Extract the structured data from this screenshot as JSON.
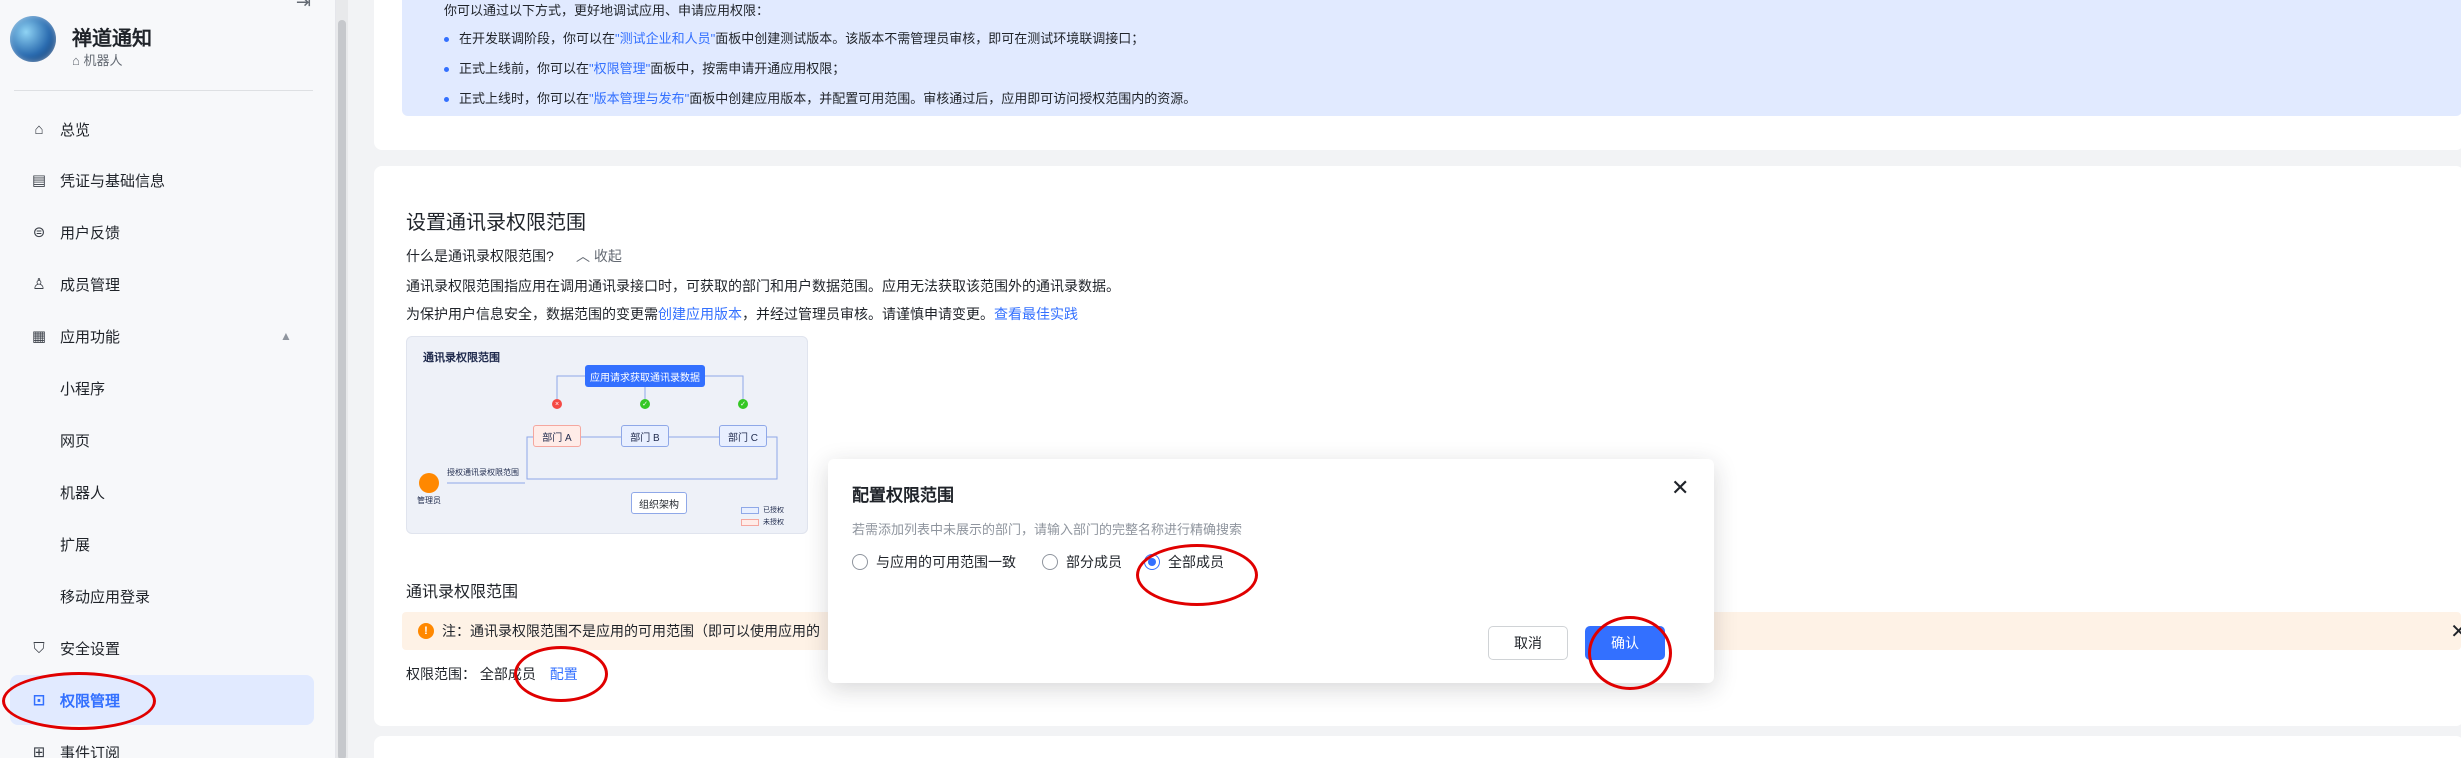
{
  "sidebar": {
    "app_name": "禅道通知",
    "app_type": "机器人",
    "items": [
      {
        "label": "总览",
        "icon": "home-icon"
      },
      {
        "label": "凭证与基础信息",
        "icon": "document-icon"
      },
      {
        "label": "用户反馈",
        "icon": "feedback-icon"
      },
      {
        "label": "成员管理",
        "icon": "user-icon"
      },
      {
        "label": "应用功能",
        "icon": "grid-icon"
      },
      {
        "label": "小程序"
      },
      {
        "label": "网页"
      },
      {
        "label": "机器人"
      },
      {
        "label": "扩展"
      },
      {
        "label": "移动应用登录"
      },
      {
        "label": "安全设置",
        "icon": "shield-icon"
      },
      {
        "label": "权限管理",
        "icon": "lock-icon"
      },
      {
        "label": "事件订阅",
        "icon": "plus-square-icon"
      }
    ]
  },
  "top_info": {
    "intro": "你可以通过以下方式，更好地调试应用、申请应用权限：",
    "b1_pre": "在开发联调阶段，你可以在",
    "b1_link": "\"测试企业和人员\"",
    "b1_post": "面板中创建测试版本。该版本不需管理员审核，即可在测试环境联调接口；",
    "b2_pre": "正式上线前，你可以在",
    "b2_link": "\"权限管理\"",
    "b2_post": "面板中，按需申请开通应用权限；",
    "b3_pre": "正式上线时，你可以在",
    "b3_link": "\"版本管理与发布\"",
    "b3_post": "面板中创建应用版本，并配置可用范围。审核通过后，应用即可访问授权范围内的资源。"
  },
  "contacts": {
    "title": "设置通讯录权限范围",
    "what_question": "什么是通讯录权限范围?",
    "collapse": "收起",
    "desc1": "通讯录权限范围指应用在调用通讯录接口时，可获取的部门和用户数据范围。应用无法获取该范围外的通讯录数据。",
    "desc2_pre": "为保护用户信息安全，数据范围的变更需",
    "desc2_link": "创建应用版本",
    "desc2_mid": "，并经过管理员审核。请谨慎申请变更。",
    "desc2_link2": "查看最佳实践",
    "diagram": {
      "title": "通讯录权限范围",
      "top": "应用请求获取通讯录数据",
      "dept_a": "部门 A",
      "dept_b": "部门 B",
      "dept_c": "部门 C",
      "org": "组织架构",
      "admin": "管理员",
      "admin_arrow": "授权通讯录权限范围",
      "legend_granted": "已授权",
      "legend_not": "未授权"
    },
    "scope_section_title": "通讯录权限范围",
    "warning": "注：通讯录权限范围不是应用的可用范围（即可以使用应用的",
    "scope_label": "权限范围：",
    "scope_value": "全部成员",
    "config_link": "配置"
  },
  "modal": {
    "title": "配置权限范围",
    "hint": "若需添加列表中未展示的部门，请输入部门的完整名称进行精确搜索",
    "options": [
      "与应用的可用范围一致",
      "部分成员",
      "全部成员"
    ],
    "selected": "全部成员",
    "cancel": "取消",
    "confirm": "确认"
  },
  "colors": {
    "accent": "#3370ff",
    "annotation": "#e00000",
    "warning": "#ff8800"
  }
}
